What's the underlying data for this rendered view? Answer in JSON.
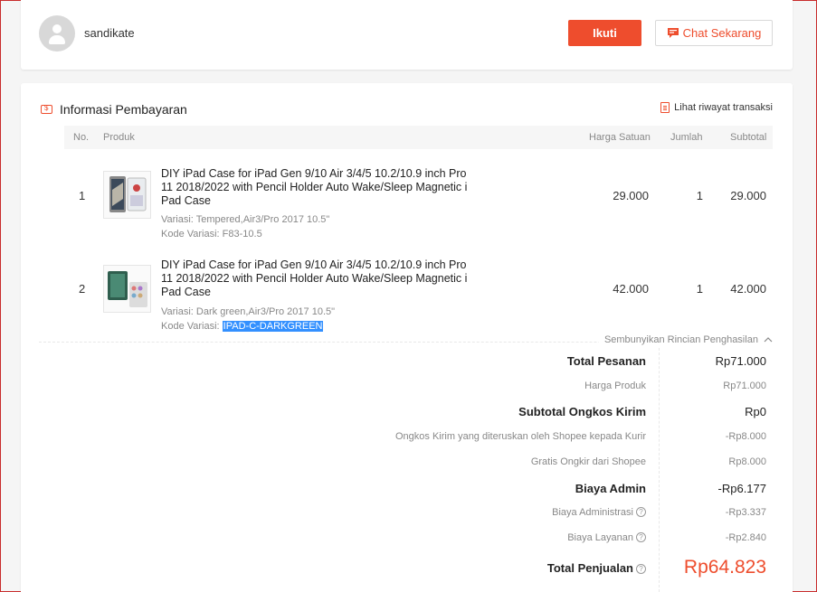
{
  "header": {
    "username": "sandikate",
    "follow_label": "Ikuti",
    "chat_label": "Chat Sekarang"
  },
  "payment": {
    "title": "Informasi Pembayaran",
    "history_link": "Lihat riwayat transaksi",
    "columns": {
      "no": "No.",
      "product": "Produk",
      "unit_price": "Harga Satuan",
      "qty": "Jumlah",
      "subtotal": "Subtotal"
    },
    "items": [
      {
        "no": "1",
        "name": "DIY iPad Case for iPad Gen 9/10 Air 3/4/5 10.2/10.9 inch Pro 11 2018/2022 with Pencil Holder Auto Wake/Sleep Magnetic i Pad Case",
        "variation": "Variasi: Tempered,Air3/Pro 2017 10.5\"",
        "code_label": "Kode Variasi: ",
        "code": "F83-10.5",
        "unit_price": "29.000",
        "qty": "1",
        "subtotal": "29.000"
      },
      {
        "no": "2",
        "name": "DIY iPad Case for iPad Gen 9/10 Air 3/4/5 10.2/10.9 inch Pro 11 2018/2022 with Pencil Holder Auto Wake/Sleep Magnetic i Pad Case",
        "variation": "Variasi: Dark green,Air3/Pro 2017 10.5\"",
        "code_label": "Kode Variasi: ",
        "code": "IPAD-C-DARKGREEN",
        "unit_price": "42.000",
        "qty": "1",
        "subtotal": "42.000"
      }
    ],
    "hide_details": "Sembunyikan Rincian Penghasilan",
    "summary": {
      "total_order_label": "Total Pesanan",
      "total_order_value": "Rp71.000",
      "product_price_label": "Harga Produk",
      "product_price_value": "Rp71.000",
      "shipping_subtotal_label": "Subtotal Ongkos Kirim",
      "shipping_subtotal_value": "Rp0",
      "shipping_forwarded_label": "Ongkos Kirim yang diteruskan oleh Shopee kepada Kurir",
      "shipping_forwarded_value": "-Rp8.000",
      "free_shipping_label": "Gratis Ongkir dari Shopee",
      "free_shipping_value": "Rp8.000",
      "admin_fee_label": "Biaya Admin",
      "admin_fee_value": "-Rp6.177",
      "administration_fee_label": "Biaya Administrasi",
      "administration_fee_value": "-Rp3.337",
      "service_fee_label": "Biaya Layanan",
      "service_fee_value": "-Rp2.840",
      "total_sales_label": "Total Penjualan",
      "total_sales_value": "Rp64.823"
    }
  },
  "colors": {
    "accent": "#ee4d2d",
    "highlight": "#3390ff"
  }
}
